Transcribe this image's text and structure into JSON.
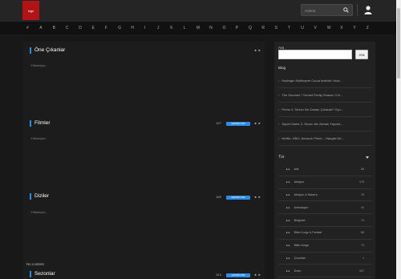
{
  "header": {
    "logo_text": "logo",
    "search_placeholder": "Arama",
    "search_icon": "search-icon",
    "user_icon": "user-icon"
  },
  "alphabet": [
    "#",
    "A",
    "B",
    "C",
    "D",
    "E",
    "F",
    "G",
    "H",
    "I",
    "J",
    "K",
    "L",
    "M",
    "N",
    "O",
    "P",
    "Q",
    "R",
    "S",
    "T",
    "U",
    "V",
    "W",
    "X",
    "Y",
    "Z"
  ],
  "sections": [
    {
      "title": "Öne Çıkanlar",
      "loading": "Yükleniyor..",
      "count": "",
      "more": ""
    },
    {
      "title": "Filmler",
      "loading": "Yükleniyor..",
      "count": "427",
      "more": "HEPSİNİ GÖR"
    },
    {
      "title": "Diziler",
      "loading": "Yükleniyor..",
      "count": "469",
      "more": "HEPSİNİ GÖR"
    },
    {
      "title": "Sezonlar",
      "loading": "",
      "count": "614",
      "more": "HEPSİNİ GÖR"
    }
  ],
  "arrows": "◂ ▸",
  "no_content": "No content",
  "sidebar": {
    "search_label": "Ara",
    "search_button": "Ara",
    "blog_title": "Blog",
    "blog_items": [
      "Hadinge! Muhteşem Cuma İndirimi: Hodi...",
      "The Summer I Turned Pretty Season 3 N...",
      "Prens 4. Sezon Ne Zaman Çıkacak? Oyu...",
      "Squid Game 3. Sezon Ne Zaman Yayınla...",
      "Netflix, HBO, Amazon Prime – Hangisi De..."
    ],
    "genre_title": "Tür",
    "genres": [
      {
        "name": "Aile",
        "count": "65"
      },
      {
        "name": "Aksiyon",
        "count": "179"
      },
      {
        "name": "Aksiyon & Macera",
        "count": "76"
      },
      {
        "name": "Animasyon",
        "count": "41"
      },
      {
        "name": "Belgesel",
        "count": "74"
      },
      {
        "name": "Bilim Kurgu & Fantazi",
        "count": "68"
      },
      {
        "name": "Bilim-Kurgu",
        "count": "73"
      },
      {
        "name": "Çocuklar",
        "count": "1"
      },
      {
        "name": "Dram",
        "count": "447"
      }
    ]
  }
}
